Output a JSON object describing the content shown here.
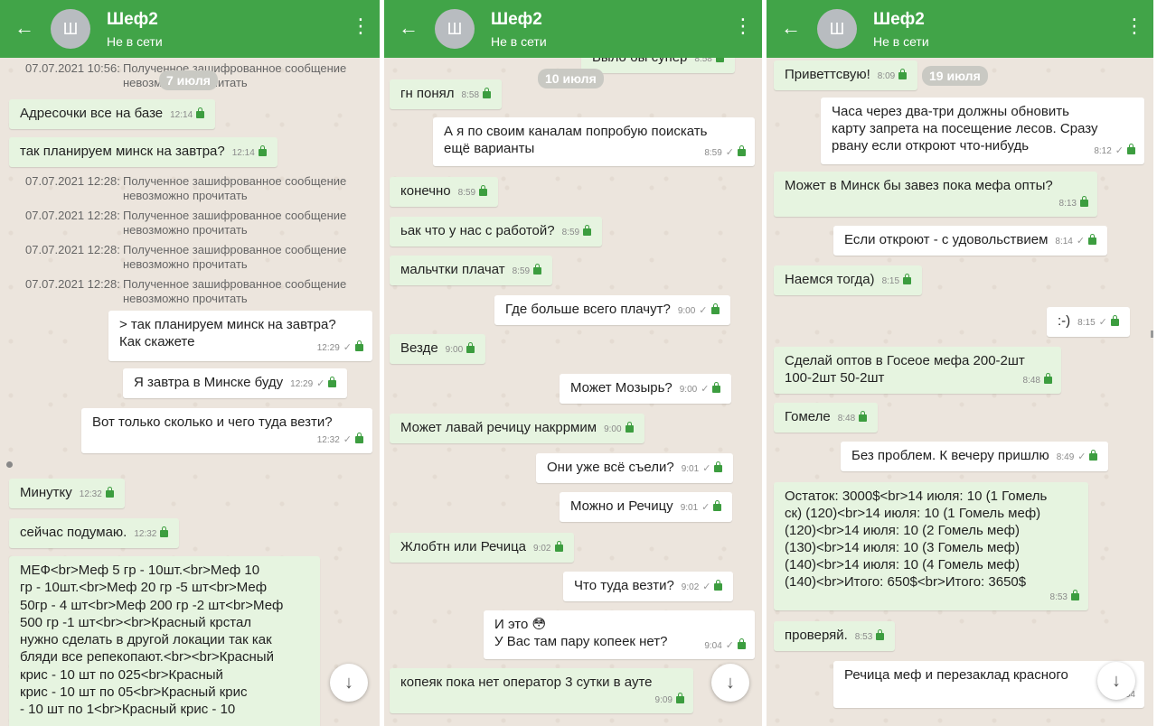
{
  "screens": [
    {
      "title": "Шеф2",
      "status": "Не в сети",
      "avatar": "Ш",
      "back_icon": "←",
      "menu_icon": "⋮"
    },
    {
      "title": "Шеф2",
      "status": "Не в сети",
      "avatar": "Ш",
      "back_icon": "←",
      "menu_icon": "⋮"
    },
    {
      "title": "Шеф2",
      "status": "Не в сети",
      "avatar": "Ш",
      "back_icon": "←",
      "menu_icon": "⋮"
    }
  ],
  "s1": {
    "sys_text": "Полученное зашифрованное сообщение\nневозможно прочитать",
    "sys": [
      {
        "date": "07.07.2021 10:56:"
      },
      {
        "date": "07.07.2021 12:28:"
      },
      {
        "date": "07.07.2021 12:28:"
      },
      {
        "date": "07.07.2021 12:28:"
      },
      {
        "date": "07.07.2021 12:28:"
      }
    ],
    "pill": "7 июля",
    "m": [
      {
        "text": "Адресочки все на базе",
        "time": "12:14"
      },
      {
        "text": "так планируем минск на завтра?",
        "time": "12:14"
      },
      {
        "text": "> так планируем минск на завтра?\nКак скажете",
        "time": "12:29"
      },
      {
        "text": "Я завтра в Минске буду",
        "time": "12:29"
      },
      {
        "text": "Вот только сколько и чего туда везти?",
        "time": "12:32"
      },
      {
        "text": "Минутку",
        "time": "12:32"
      },
      {
        "text": "сейчас подумаю.",
        "time": "12:32"
      },
      {
        "text": "МЕФ<br>Меф 5 гр - 10шт.<br>Меф 10\nгр - 10шт.<br>Меф 20 гр -5 шт<br>Меф\n50гр - 4 шт<br>Меф 200 гр -2 шт<br>Меф\n500 гр -1 шт<br><br>Красный крстал\nнужно сделать в другой локации так как\nбляди все репекопают.<br><br>Красный\nкрис - 10 шт по 025<br>Красный\nкрис - 10 шт по 05<br>Красный крис\n- 10 шт по 1<br>Красный крис - 10"
      }
    ],
    "fab": "↓"
  },
  "s2": {
    "pill": "10 июля",
    "m": [
      {
        "text": "Было бы супер",
        "time": "8:58"
      },
      {
        "text": "гн  понял",
        "time": "8:58"
      },
      {
        "text": "А я по своим каналам попробую поискать\nещё варианты",
        "time": "8:59"
      },
      {
        "text": "конечно",
        "time": "8:59"
      },
      {
        "text": "ьак что у нас с работой?",
        "time": "8:59"
      },
      {
        "text": "мальчтки плачат",
        "time": "8:59"
      },
      {
        "text": "Где больше всего плачут?",
        "time": "9:00"
      },
      {
        "text": "Везде",
        "time": "9:00"
      },
      {
        "text": "Может Мозырь?",
        "time": "9:00"
      },
      {
        "text": "Может лавай речицу накррмим",
        "time": "9:00"
      },
      {
        "text": "Они уже всё съели?",
        "time": "9:01"
      },
      {
        "text": "Можно и Речицу",
        "time": "9:01"
      },
      {
        "text": "Жлобтн или Речица",
        "time": "9:02"
      },
      {
        "text": "Что туда везти?",
        "time": "9:02"
      },
      {
        "text": "И это 😳\nУ Вас там пару копеек нет?",
        "time": "9:04"
      },
      {
        "text": "копеяк пока нет оператор 3 сутки в ауте",
        "time": "9:09"
      }
    ],
    "fab": "↓"
  },
  "s3": {
    "pill": "19 июля",
    "m": [
      {
        "text": "Приветтсвую!",
        "time": "8:09"
      },
      {
        "text": "Часа через два-три должны обновить\nкарту запрета на посещение лесов. Сразу\nрвану если откроют что-нибудь",
        "time": "8:12"
      },
      {
        "text": "Может в Минск бы завез пока мефа опты?",
        "time": "8:13"
      },
      {
        "text": "Если откроют - с удовольствием",
        "time": "8:14"
      },
      {
        "text": "Наемся тогда)",
        "time": "8:15"
      },
      {
        "text": ":-)",
        "time": "8:15"
      },
      {
        "text": "Сделай оптов в Госеое мефа 200-2шт\n100-2шт 50-2шт",
        "time": "8:48"
      },
      {
        "text": "Гомеле",
        "time": "8:48"
      },
      {
        "text": "Без проблем. К вечеру пришлю",
        "time": "8:49"
      },
      {
        "text": "Остаток: 3000$<br>14 июля: 10 (1 Гомель\nск) (120)<br>14 июля: 10 (1 Гомель меф)\n(120)<br>14 июля: 10 (2 Гомель меф)\n(130)<br>14 июля: 10 (3 Гомель меф)\n(140)<br>14 июля: 10 (4 Гомель меф)\n(140)<br>Итого: 650$<br>Итого: 3650$",
        "time": "8:53"
      },
      {
        "text": "проверяй.",
        "time": "8:53"
      },
      {
        "text": "Речица меф и перезаклад красного",
        "time": "8:54"
      }
    ],
    "fab": "↓"
  },
  "colors": {
    "header": "#41a448",
    "incoming": "#e6f4e0",
    "outgoing": "#ffffff",
    "chat_bg": "#ece5dd"
  }
}
